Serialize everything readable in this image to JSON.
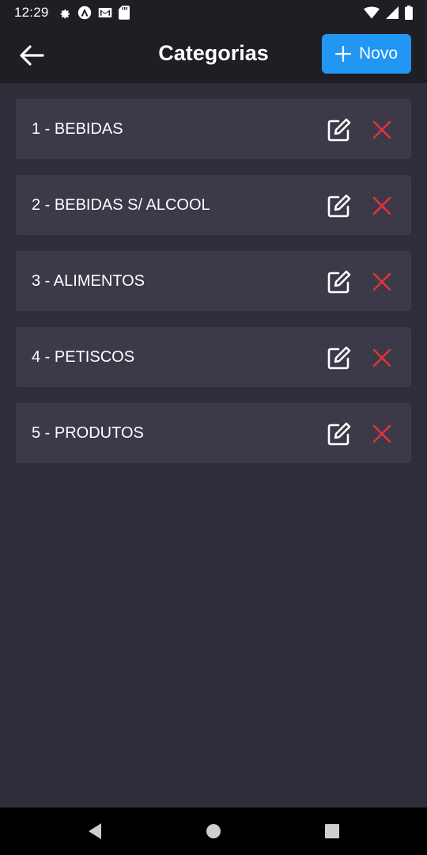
{
  "status_bar": {
    "time": "12:29",
    "icons_left": [
      "gear-icon",
      "app-icon",
      "mail-icon",
      "sd-card-icon"
    ],
    "icons_right": [
      "wifi-icon",
      "signal-icon",
      "battery-icon"
    ]
  },
  "header": {
    "title": "Categorias",
    "back_icon": "arrow-left-icon",
    "new_button": {
      "icon": "plus-icon",
      "label": "Novo"
    },
    "accent_color": "#2196f3"
  },
  "categories": [
    {
      "label": "1 - BEBIDAS",
      "edit_icon": "edit-icon",
      "delete_icon": "close-icon"
    },
    {
      "label": "2 - BEBIDAS S/ ALCOOL",
      "edit_icon": "edit-icon",
      "delete_icon": "close-icon"
    },
    {
      "label": "3 - ALIMENTOS",
      "edit_icon": "edit-icon",
      "delete_icon": "close-icon"
    },
    {
      "label": "4 - PETISCOS",
      "edit_icon": "edit-icon",
      "delete_icon": "close-icon"
    },
    {
      "label": "5 - PRODUTOS",
      "edit_icon": "edit-icon",
      "delete_icon": "close-icon"
    }
  ],
  "colors": {
    "background": "#2f2d39",
    "card": "#3c3a48",
    "bar": "#1f1e24",
    "delete": "#e0333a"
  },
  "nav_bar": {
    "buttons": [
      "back-triangle-icon",
      "home-circle-icon",
      "recents-square-icon"
    ]
  }
}
